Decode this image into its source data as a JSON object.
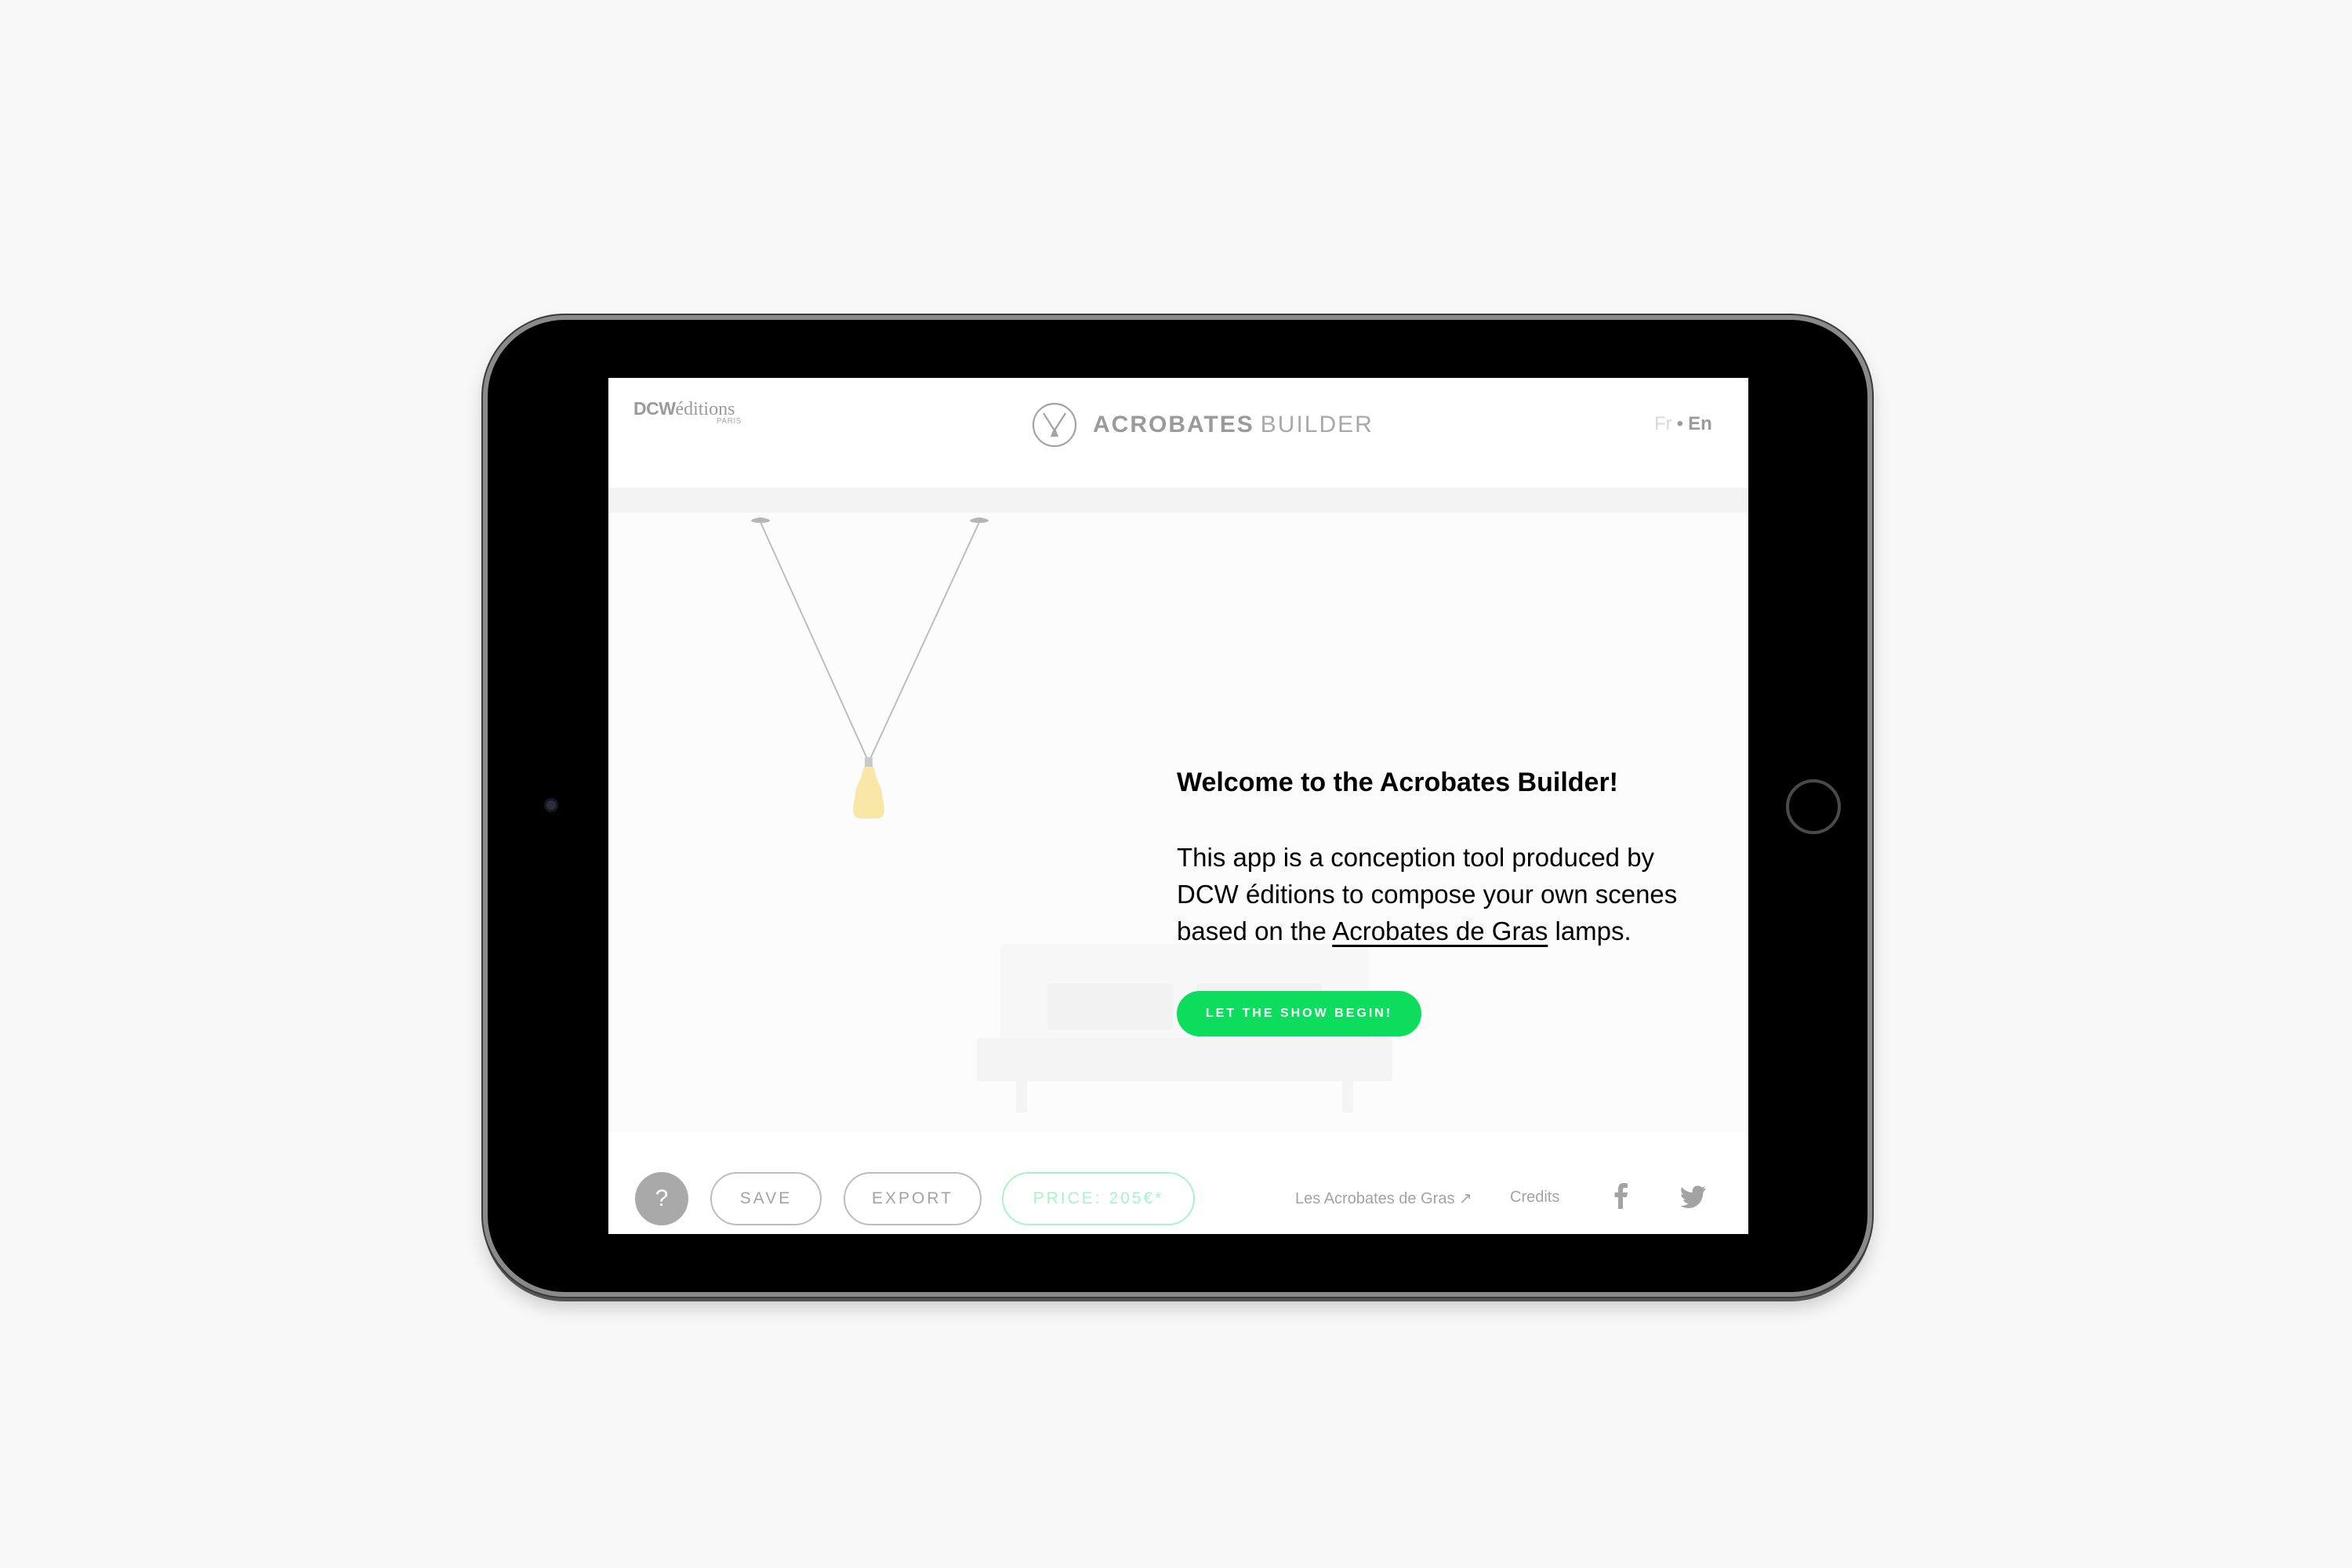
{
  "header": {
    "brand": {
      "main": "DCW",
      "serif": "éditions",
      "city": "PARIS"
    },
    "title_bold": "ACROBATES",
    "title_light": "BUILDER",
    "lang": {
      "fr": "Fr",
      "sep": "•",
      "en": "En",
      "active": "En"
    }
  },
  "welcome": {
    "title": "Welcome to the Acrobates Builder!",
    "body_before": "This app is a conception tool produced by DCW éditions to compose your own scenes based on the ",
    "body_link": "Acrobates de Gras",
    "body_after": " lamps.",
    "cta": "LET THE SHOW BEGIN!"
  },
  "footer": {
    "help": "?",
    "save": "SAVE",
    "export": "EXPORT",
    "price": "PRICE: 205€*",
    "link_acrobates": "Les Acrobates de Gras ↗",
    "credits": "Credits"
  },
  "icons": {
    "app": "acrobates-logo-icon",
    "settings": "sliders-icon",
    "facebook": "facebook-icon",
    "twitter": "twitter-icon"
  },
  "colors": {
    "accent": "#0ddd5c",
    "accent_light": "#a9f3c8",
    "lamp_shade": "#f8e7a6",
    "muted_text": "#a3a3a3"
  }
}
